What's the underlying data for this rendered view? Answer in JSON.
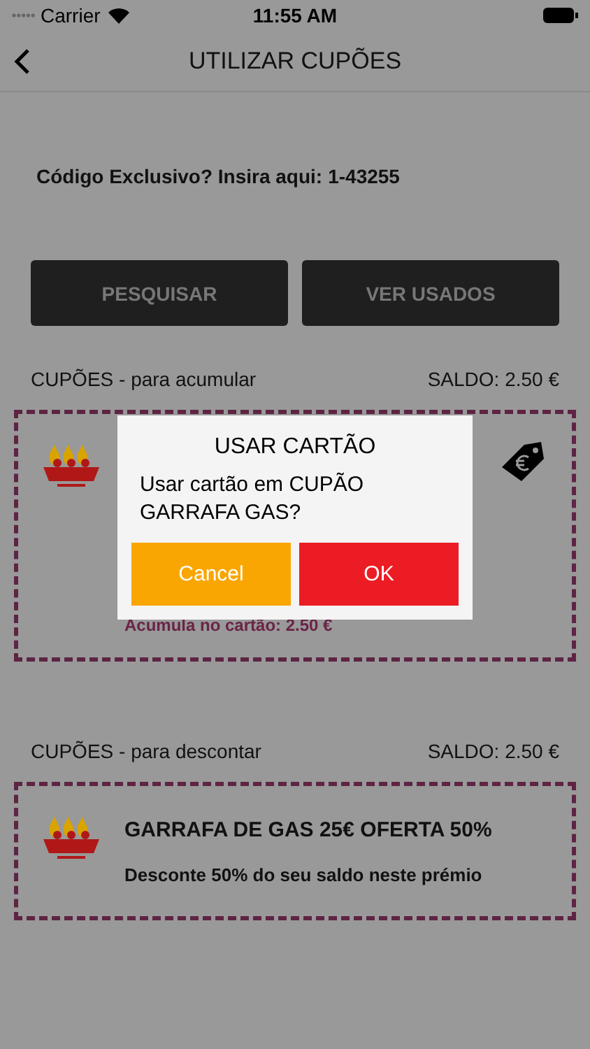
{
  "status_bar": {
    "carrier": "Carrier",
    "time": "11:55 AM"
  },
  "nav": {
    "title": "UTILIZAR CUPÕES"
  },
  "code": {
    "label": "Código Exclusivo? Insira aqui:",
    "value": "1-43255"
  },
  "buttons": [
    "PESQUISAR",
    "VER USADOS"
  ],
  "sections": [
    {
      "title": "CUPÕES - para acumular",
      "balance": "SALDO: 2.50 €",
      "coupons": [
        {
          "kind": "accumulate",
          "note": "Acumula no cartão: 2.50 €"
        }
      ]
    },
    {
      "title": "CUPÕES - para descontar",
      "balance": "SALDO: 2.50 €",
      "coupons": [
        {
          "kind": "discount",
          "title": "GARRAFA DE GAS 25€ OFERTA 50%",
          "description": "Desconte 50% do seu saldo neste prémio"
        }
      ]
    }
  ],
  "dialog": {
    "title": "USAR CARTÃO",
    "message": "Usar cartão em CUPÃO GARRAFA GAS?",
    "cancel": "Cancel",
    "ok": "OK"
  }
}
